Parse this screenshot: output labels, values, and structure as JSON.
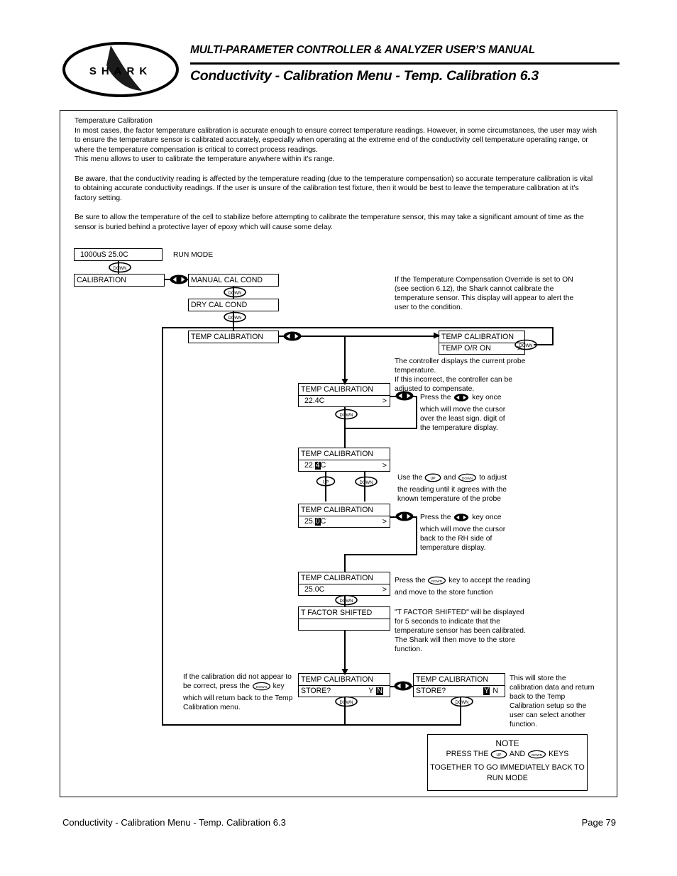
{
  "header": {
    "manual_title": "MULTI-PARAMETER CONTROLLER & ANALYZER USER’S MANUAL",
    "section_title": "Conductivity - Calibration Menu - Temp. Calibration 6.3",
    "logo_text": "SHARK"
  },
  "intro": {
    "heading": "Temperature Calibration",
    "p1": "In most cases, the factor temperature calibration is accurate enough to ensure correct temperature readings. However, in some circumstances, the user may wish to ensure the temperature sensor is calibrated accurately, especially when operating at the extreme end of the conductivity cell temperature operating range, or where the temperature compensation is critical to correct process readings.",
    "p2": "This menu allows to user to calibrate the temperature anywhere within it's range.",
    "p3": "Be aware, that the conductivity reading is affected by the temperature reading (due to the temperature compensation) so accurate temperature calibration is vital to obtaining accurate conductivity readings. If the user is unsure of the calibration test fixture, then it would be best to leave the temperature calibration at it's factory setting.",
    "p4": "Be sure to allow the temperature of the cell to stabilize before attempting to calibrate the temperature sensor, this may take a significant amount of time as the sensor is buried behind a protective layer of epoxy which will cause some delay."
  },
  "flow": {
    "run_display": "1000uS  25.0C",
    "run_label": "RUN MODE",
    "calibration": "CALIBRATION",
    "manual_cal_cond": "MANUAL CAL COND",
    "dry_cal_cond": "DRY CAL COND",
    "temp_calibration": "TEMP CALIBRATION",
    "temp_or_on": "TEMP O/R ON",
    "gt": ">",
    "temp_224": "22.4C",
    "temp_224_pre": "22.",
    "temp_224_cursor": "4",
    "temp_224_post": "C",
    "temp_250_pre": "25.",
    "temp_250_cursor": "0",
    "temp_250_post": "C",
    "temp_250": "25.0C",
    "t_factor_shifted": "T  FACTOR  SHIFTED",
    "store_label": "STORE?",
    "store_y": "Y",
    "store_n": "N"
  },
  "annotations": {
    "override": "If the Temperature Compensation Override is set to ON (see section 6.12), the Shark cannot calibrate the temperature sensor. This display will appear to alert the user to the condition.",
    "probe_temp": "The controller displays the current probe temperature.\nIf this incorrect, the controller can be adjusted to compensate.",
    "press_lr_1a": "Press the",
    "press_lr_1b": "key once which will move the cursor over the least sign. digit of the temperature display.",
    "use_updown_a": "Use the",
    "use_updown_b": "and",
    "use_updown_c": "to adjust the reading until it agrees with the known temperature of the probe",
    "press_lr_2a": "Press the",
    "press_lr_2b": "key once which will move the cursor back to the RH side of temperature display.",
    "press_down_a": "Press the",
    "press_down_b": "key to accept the reading and move to the store function",
    "t_factor_note": "\"T FACTOR SHIFTED\" will be displayed for 5 seconds to indicate that the temperature sensor has been calibrated.\nThe Shark will then move to the store function.",
    "store_no_a": "If the calibration did not appear to be correct, press the",
    "store_no_b": "key which will return back to the Temp Calibration menu.",
    "store_yes": "This will store the calibration data and return back to the Temp Calibration   setup so the user can select another function."
  },
  "note_box": {
    "title": "NOTE",
    "line1a": "PRESS THE",
    "line1b": "AND",
    "line1c": "KEYS",
    "line2": "TOGETHER TO GO IMMEDIATELY BACK TO",
    "line3": "RUN MODE"
  },
  "keys": {
    "up": "UP",
    "down": "DOWN"
  },
  "footer": {
    "left": "Conductivity - Calibration Menu - Temp. Calibration 6.3",
    "right": "Page 79"
  }
}
